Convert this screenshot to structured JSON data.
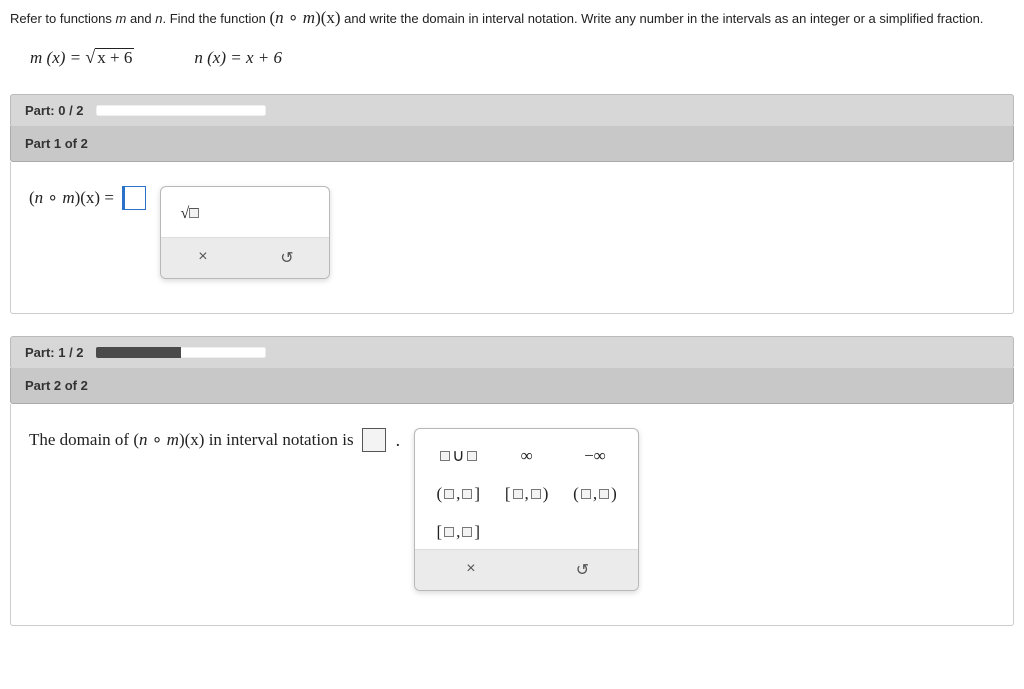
{
  "question": {
    "line1_a": "Refer to functions ",
    "m": "m",
    "line1_b": " and ",
    "n": "n",
    "line1_c": ". Find the function ",
    "comp_open": "(",
    "comp_mid": " ∘ ",
    "comp_close": ")(x)",
    "line1_d": " and write the domain in interval notation. Write any number in the intervals as an integer or a simplified fraction."
  },
  "functions": {
    "m_left": "m (x) = ",
    "m_sqrt_arg": "x + 6",
    "n_expr": "n (x) = x + 6"
  },
  "part0": {
    "label": "Part: 0 / 2",
    "progress_pct": 0
  },
  "part1_header": "Part 1 of 2",
  "part1": {
    "lhs_open": "(",
    "lhs_n": "n",
    "lhs_circ": " ∘ ",
    "lhs_m": "m",
    "lhs_close": ")(x) = ",
    "tool_sqrt_label": "√",
    "tool_clear": "×",
    "tool_undo": "↺"
  },
  "part_mid": {
    "label": "Part: 1 / 2",
    "progress_pct": 50
  },
  "part2_header": "Part 2 of 2",
  "part2": {
    "text_a": "The domain of ",
    "paren_open": "(",
    "n": "n",
    "circ": " ∘ ",
    "m": "m",
    "paren_close": ")(x)",
    "text_b": " in interval notation is ",
    "period": ".",
    "tools": {
      "union": "∪",
      "inf": "∞",
      "ninf": "−∞",
      "oc": "(□,□]",
      "co": "[□,□)",
      "oo": "(□,□)",
      "cc": "[□,□]",
      "clear": "×",
      "undo": "↺"
    }
  }
}
